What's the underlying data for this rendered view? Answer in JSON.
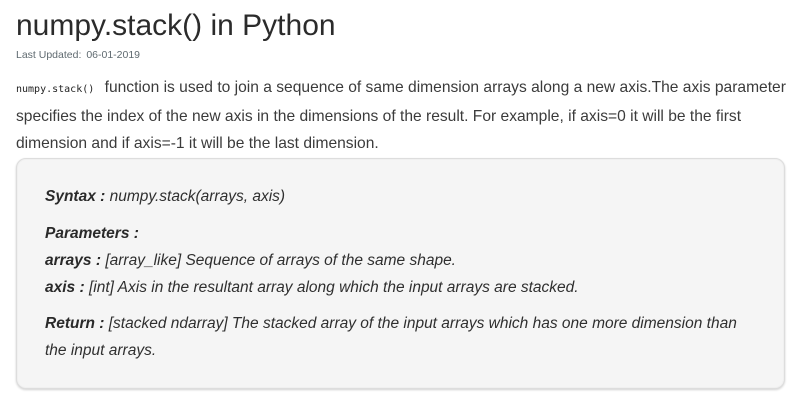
{
  "article": {
    "title": "numpy.stack() in Python",
    "last_updated_label": "Last Updated:",
    "last_updated_value": "06-01-2019",
    "intro_code": "numpy.stack()",
    "intro_text": "function is used to join a sequence of same dimension arrays along a new axis.The axis parameter specifies the index of the new axis in the dimensions of the result. For example, if axis=0 it will be the first dimension and if axis=-1 it will be the last dimension."
  },
  "syntax_box": {
    "syntax_label": "Syntax :",
    "syntax_value": "numpy.stack(arrays, axis)",
    "parameters_label": "Parameters :",
    "arrays_label": "arrays :",
    "arrays_value": "[array_like] Sequence of arrays of the same shape.",
    "axis_label": "axis :",
    "axis_value": "[int] Axis in the resultant array along which the input arrays are stacked.",
    "return_label": "Return :",
    "return_value": "[stacked ndarray] The stacked array of the input arrays which has one more dimension than the input arrays."
  }
}
